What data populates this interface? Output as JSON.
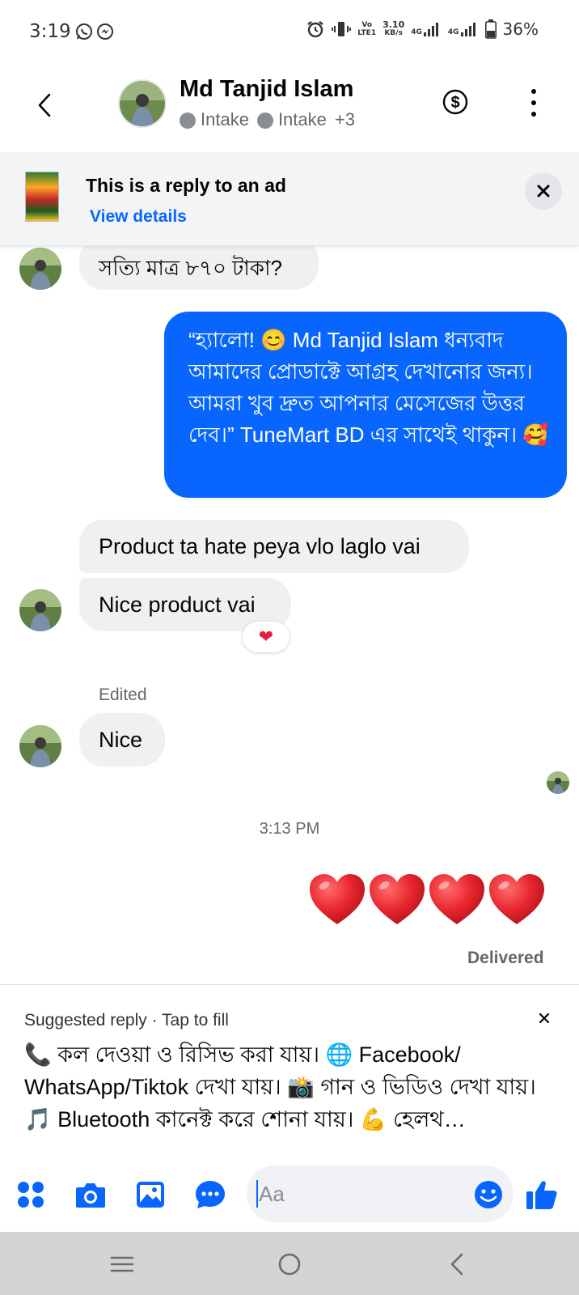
{
  "status_bar": {
    "time": "3:19",
    "net_top": "Vo",
    "net_bottom": "LTE1",
    "speed_value": "3.10",
    "speed_unit": "KB/s",
    "sim1": "4G",
    "sim2": "4G",
    "battery": "36%"
  },
  "header": {
    "contact_name": "Md Tanjid Islam",
    "label_1": "Intake",
    "label_2": "Intake",
    "label_more": "+3"
  },
  "ad_banner": {
    "title": "This is a reply to an ad",
    "link": "View details"
  },
  "messages": {
    "m1": "সত্যি মাত্র ৮৭০ টাকা?",
    "m2": "“হ্যালো! 😊 Md Tanjid Islam  ধন্যবাদ আমাদের প্রোডাক্টে আগ্রহ দেখানোর জন্য। আমরা খুব দ্রুত আপনার মেসেজের উত্তর দেব।” TuneMart BD এর সাথেই থাকুন। 🥰",
    "m3": "Product ta hate peya vlo laglo vai",
    "m4": "Nice product vai",
    "m4_reaction": "❤",
    "edited": "Edited",
    "m5": "Nice",
    "timestamp": "3:13 PM",
    "delivered": "Delivered"
  },
  "suggested_reply": {
    "header": "Suggested reply · Tap to fill",
    "text": "📞 কল দেওয়া ও রিসিভ করা যায়। 🌐 Facebook/ WhatsApp/Tiktok দেখা যায়। 📸 গান ও ভিডিও দেখা যায়। 🎵 Bluetooth কানেক্ট করে শোনা যায়। 💪 হেলথ…"
  },
  "composer": {
    "placeholder": "Aa"
  },
  "colors": {
    "accent": "#0866ff",
    "incoming_bubble": "#f0f0f0",
    "secondary_text": "#65676b",
    "heart": "#e41e3f"
  }
}
